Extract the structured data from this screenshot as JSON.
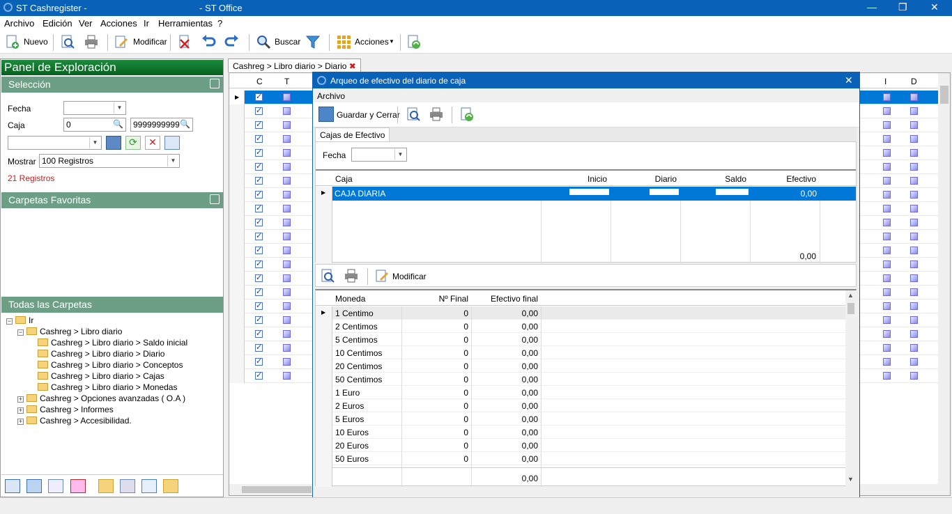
{
  "window": {
    "title_left": "ST Cashregister -",
    "title_right": "- ST Office",
    "btn_min": "—",
    "btn_max": "❐",
    "btn_close": "✕"
  },
  "menu": {
    "items": [
      "Archivo",
      "Edición",
      "Ver",
      "Acciones",
      "Ir",
      "Herramientas",
      "?"
    ]
  },
  "toolbar": {
    "nuevo": "Nuevo",
    "modificar": "Modificar",
    "buscar": "Buscar",
    "acciones": "Acciones"
  },
  "left_panel": {
    "title": "Panel de Exploración",
    "seleccion": {
      "header": "Selección",
      "fecha_label": "Fecha",
      "fecha_value": "",
      "caja_label": "Caja",
      "caja_from": "0",
      "caja_to": "9999999999",
      "mostrar_label": "Mostrar",
      "mostrar_value": "100  Registros",
      "registros": "21 Registros"
    },
    "favoritas": {
      "header": "Carpetas Favoritas"
    },
    "todas": {
      "header": "Todas las Carpetas"
    },
    "tree": [
      "Ir",
      "Cashreg > Libro diario",
      "Cashreg > Libro diario > Saldo inicial",
      "Cashreg > Libro diario > Diario",
      "Cashreg > Libro diario > Conceptos",
      "Cashreg > Libro diario > Cajas",
      "Cashreg > Libro diario > Monedas",
      "Cashreg > Opciones avanzadas ( O.A )",
      "Cashreg > Informes",
      "Cashreg > Accesibilidad."
    ]
  },
  "main": {
    "tab": "Cashreg > Libro diario > Diario",
    "tab_close": "✖",
    "columns": {
      "c": "C",
      "t": "T",
      "i": "I",
      "d": "D"
    }
  },
  "dialog": {
    "title": "Arqueo de efectivo del diario de caja",
    "close": "✕",
    "menu": "Archivo",
    "guardar": "Guardar y Cerrar",
    "tab": "Cajas de Efectivo",
    "fecha_label": "Fecha",
    "fecha_value": "",
    "cajas_headers": [
      "Caja",
      "Inicio",
      "Diario",
      "Saldo",
      "Efectivo"
    ],
    "cajas_rows": [
      {
        "caja": "CAJA DIARIA",
        "inicio": "",
        "diario": "",
        "saldo": "",
        "efectivo": "0,00"
      }
    ],
    "cajas_totals": {
      "efectivo": "0,00"
    },
    "modificar": "Modificar",
    "monedas_headers": [
      "Moneda",
      "Nº Final",
      "Efectivo final"
    ],
    "monedas_rows": [
      {
        "moneda": "1 Centimo",
        "n": "0",
        "ef": "0,00"
      },
      {
        "moneda": "2 Centimos",
        "n": "0",
        "ef": "0,00"
      },
      {
        "moneda": "5 Centimos",
        "n": "0",
        "ef": "0,00"
      },
      {
        "moneda": "10 Centimos",
        "n": "0",
        "ef": "0,00"
      },
      {
        "moneda": "20 Centimos",
        "n": "0",
        "ef": "0,00"
      },
      {
        "moneda": "50 Centimos",
        "n": "0",
        "ef": "0,00"
      },
      {
        "moneda": "1 Euro",
        "n": "0",
        "ef": "0,00"
      },
      {
        "moneda": "2 Euros",
        "n": "0",
        "ef": "0,00"
      },
      {
        "moneda": "5 Euros",
        "n": "0",
        "ef": "0,00"
      },
      {
        "moneda": "10 Euros",
        "n": "0",
        "ef": "0,00"
      },
      {
        "moneda": "20 Euros",
        "n": "0",
        "ef": "0,00"
      },
      {
        "moneda": "50 Euros",
        "n": "0",
        "ef": "0,00"
      }
    ],
    "monedas_total": "0,00"
  },
  "colors": {
    "accent": "#0a61b8",
    "panel_green": "#06621e",
    "section_green": "#6d9f86",
    "selection": "#0078d7"
  }
}
